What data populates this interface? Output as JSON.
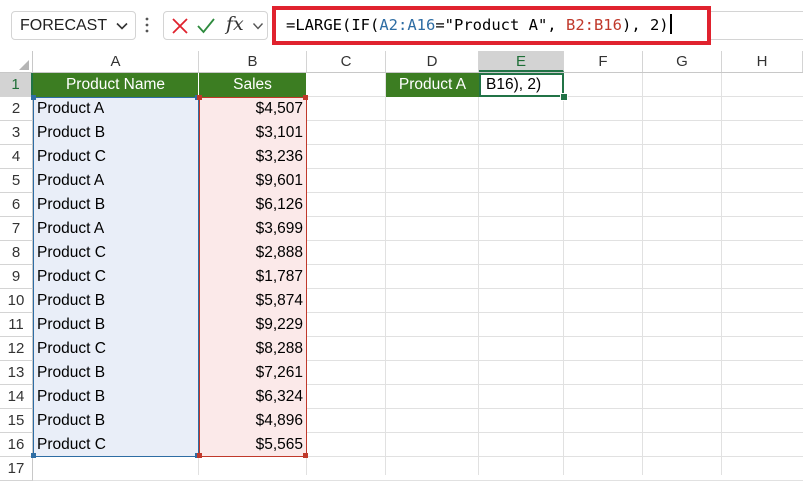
{
  "name_box": {
    "value": "FORECAST"
  },
  "formula_bar": {
    "fx_label": "fx",
    "formula_parts": [
      {
        "text": "=LARGE(IF(",
        "color": "black"
      },
      {
        "text": "A2:A16",
        "color": "blue"
      },
      {
        "text": "=\"Product A\", ",
        "color": "black"
      },
      {
        "text": "B2:B16",
        "color": "red"
      },
      {
        "text": "), 2)",
        "color": "black"
      }
    ]
  },
  "columns": [
    "A",
    "B",
    "C",
    "D",
    "E",
    "F",
    "G",
    "H"
  ],
  "rows": [
    "1",
    "2",
    "3",
    "4",
    "5",
    "6",
    "7",
    "8",
    "9",
    "10",
    "11",
    "12",
    "13",
    "14",
    "15",
    "16",
    "17"
  ],
  "table": {
    "headers": {
      "product": "Product Name",
      "sales": "Sales"
    },
    "rows": [
      {
        "product": "Product A",
        "sales": "$4,507"
      },
      {
        "product": "Product B",
        "sales": "$3,101"
      },
      {
        "product": "Product C",
        "sales": "$3,236"
      },
      {
        "product": "Product A",
        "sales": "$9,601"
      },
      {
        "product": "Product B",
        "sales": "$6,126"
      },
      {
        "product": "Product A",
        "sales": "$3,699"
      },
      {
        "product": "Product C",
        "sales": "$2,888"
      },
      {
        "product": "Product C",
        "sales": "$1,787"
      },
      {
        "product": "Product B",
        "sales": "$5,874"
      },
      {
        "product": "Product B",
        "sales": "$9,229"
      },
      {
        "product": "Product C",
        "sales": "$8,288"
      },
      {
        "product": "Product B",
        "sales": "$7,261"
      },
      {
        "product": "Product B",
        "sales": "$6,324"
      },
      {
        "product": "Product B",
        "sales": "$4,896"
      },
      {
        "product": "Product C",
        "sales": "$5,565"
      }
    ]
  },
  "criteria_label": "Product A",
  "active_cell": {
    "column": "E",
    "row": "1",
    "content": "B16), 2)"
  },
  "colors": {
    "header_green": "#3c7d22",
    "range_blue": "#2e6da4",
    "range_red": "#c0392b",
    "highlight_red": "#e0222e",
    "selection_green": "#217346"
  }
}
